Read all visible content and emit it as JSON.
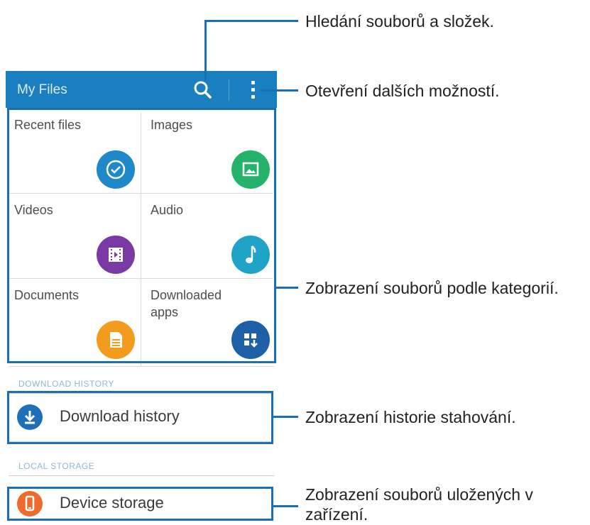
{
  "app": {
    "title": "My Files"
  },
  "categories": [
    {
      "label": "Recent files",
      "icon": "clock-icon",
      "color": "#1e88c9"
    },
    {
      "label": "Images",
      "icon": "image-icon",
      "color": "#25b36b"
    },
    {
      "label": "Videos",
      "icon": "film-icon",
      "color": "#7a3aa6"
    },
    {
      "label": "Audio",
      "icon": "music-note-icon",
      "color": "#1fa3c7"
    },
    {
      "label": "Documents",
      "icon": "document-icon",
      "color": "#f29b1d"
    },
    {
      "label": "Downloaded apps",
      "icon": "apps-download-icon",
      "color": "#1e5fa8"
    }
  ],
  "sections": {
    "download_history_header": "DOWNLOAD HISTORY",
    "local_storage_header": "LOCAL STORAGE"
  },
  "rows": {
    "download_history": {
      "label": "Download history",
      "icon": "download-icon",
      "color": "#1f6fb8"
    },
    "device_storage": {
      "label": "Device storage",
      "icon": "phone-icon",
      "color": "#ef6a2c"
    }
  },
  "annotations": {
    "search": "Hledání souborů a složek.",
    "more": "Otevření dalších možností.",
    "categories": "Zobrazení souborů podle kategorií.",
    "download_history": "Zobrazení historie stahování.",
    "device_storage_line1": "Zobrazení souborů uložených v",
    "device_storage_line2": "zařízení."
  },
  "colors": {
    "app_bar": "#1a7fc0",
    "callout": "#1b6fb5"
  }
}
